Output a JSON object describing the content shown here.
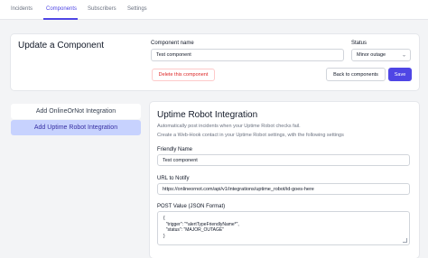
{
  "tabs": [
    {
      "label": "Incidents"
    },
    {
      "label": "Components"
    },
    {
      "label": "Subscribers"
    },
    {
      "label": "Settings"
    }
  ],
  "active_tab": "Components",
  "update_card": {
    "title": "Update a Component",
    "name_label": "Component name",
    "name_value": "Test component",
    "status_label": "Status",
    "status_value": "Minor outage",
    "delete_label": "Delete this component",
    "back_label": "Back to components",
    "save_label": "Save"
  },
  "sidebar": {
    "items": [
      {
        "label": "Add OnlineOrNot Integration"
      },
      {
        "label": "Add Uptime Robot Integration"
      }
    ],
    "active_index": 1
  },
  "integration": {
    "title": "Uptime Robot Integration",
    "description": "Automatically post incidents when your Uptime Robot checks fail.",
    "instructions": "Create a Web-Hook contact in your Uptime Robot settings, with the following settings",
    "friendly_name_label": "Friendly Name",
    "friendly_name_value": "Test component",
    "url_label": "URL to Notify",
    "url_value": "https://onlineornot.com/api/v1/integrations/uptime_robot/id-goes-here",
    "post_label": "POST Value (JSON Format)",
    "post_lines": [
      "{",
      "  \"trigger\": \"*alertTypeFriendlyName*\",",
      "  \"status\": \"MAJOR_OUTAGE\"",
      "}"
    ]
  },
  "colors": {
    "accent": "#4f46e5",
    "danger": "#dc2626",
    "active_side_bg": "#c7d2fe"
  }
}
